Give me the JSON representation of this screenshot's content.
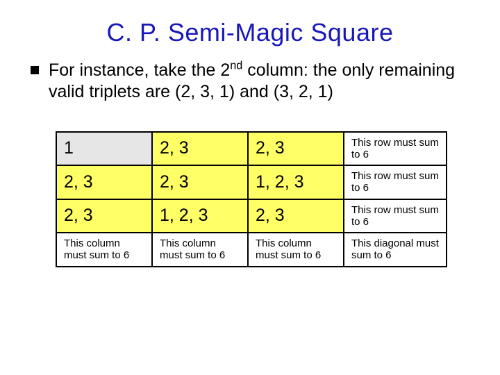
{
  "title": "C. P.  Semi-Magic Square",
  "bullet": {
    "pre": "For instance, take the 2",
    "sup": "nd",
    "post": " column: the only remaining valid triplets are (2, 3, 1) and (3, 2, 1)"
  },
  "rows": [
    {
      "c1": "1",
      "c2": "2, 3",
      "c3": "2, 3",
      "note": "This row must sum to 6",
      "bg": [
        "gray",
        "yellow",
        "yellow"
      ]
    },
    {
      "c1": "2, 3",
      "c2": "2, 3",
      "c3": "1, 2, 3",
      "note": "This row must sum to 6",
      "bg": [
        "yellow",
        "yellow",
        "yellow"
      ]
    },
    {
      "c1": "2, 3",
      "c2": "1, 2, 3",
      "c3": "2, 3",
      "note": "This row must sum to 6",
      "bg": [
        "yellow",
        "yellow",
        "yellow"
      ]
    }
  ],
  "footer": {
    "c1": "This column must sum to 6",
    "c2": "This column must sum to 6",
    "c3": "This column must sum to 6",
    "c4": "This diagonal must sum to 6"
  }
}
